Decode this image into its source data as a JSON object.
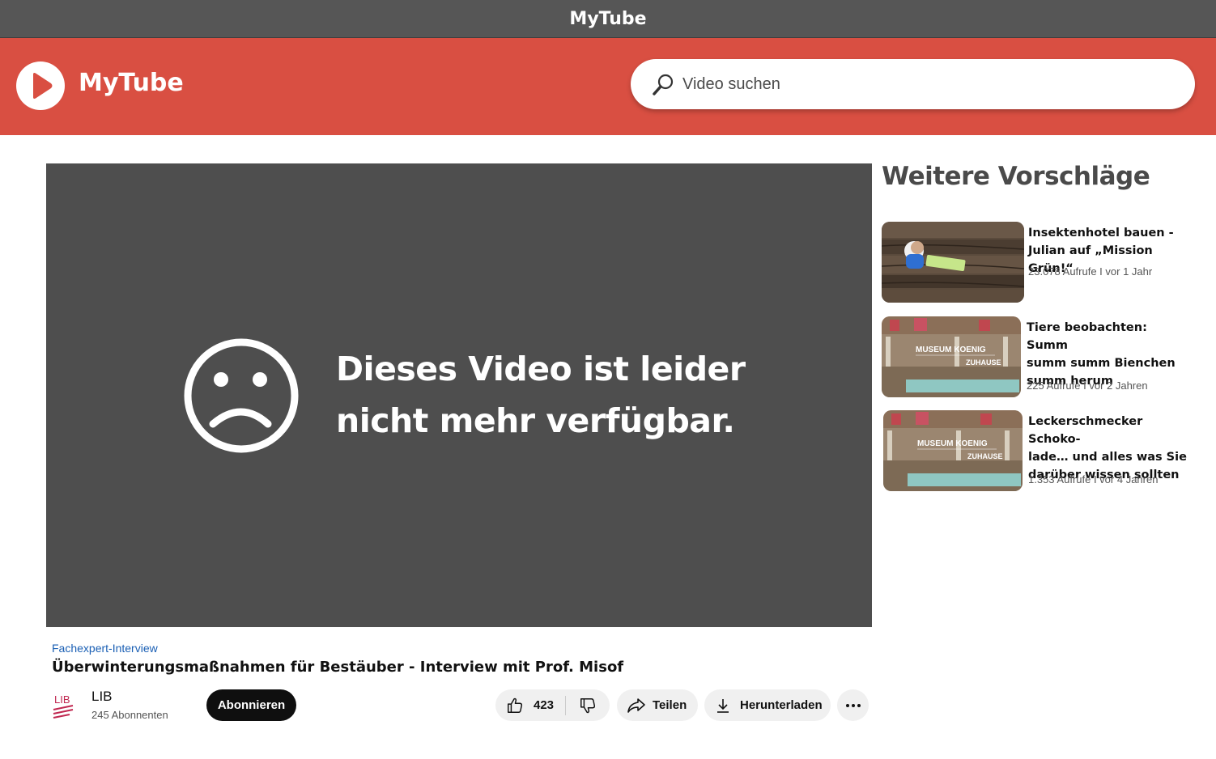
{
  "window": {
    "title": "MyTube"
  },
  "header": {
    "logo_text": "MyTube",
    "search_placeholder": "Video suchen"
  },
  "player": {
    "message_line1": "Dieses Video ist leider",
    "message_line2": "nicht mehr verfügbar."
  },
  "video": {
    "category": "Fachexpert-Interview",
    "title": "Überwinterungsmaßnahmen für Bestäuber - Interview mit Prof. Misof",
    "channel": {
      "logo_text": "LIB",
      "name": "LIB",
      "subscribers": "245 Abonnenten"
    },
    "subscribe_label": "Abonnieren",
    "likes": "423",
    "share_label": "Teilen",
    "download_label": "Herunterladen"
  },
  "sidebar": {
    "title": "Weitere Vorschläge",
    "items": [
      {
        "title_line1": "Insektenhotel bauen -",
        "title_line2": "Julian auf „Mission Grün!“",
        "title_line3": "",
        "meta": "23.078 Aufrufe I vor 1 Jahr",
        "thumb": "wooden-insect-hotel"
      },
      {
        "title_line1": "Tiere beobachten: Summ",
        "title_line2": "summ summ Bienchen",
        "title_line3": "summ herum",
        "meta": "225 Aufrufe I vor 2 Jahren",
        "thumb": "museum-hall",
        "thumb_line1": "MUSEUM KOENIG",
        "thumb_line2": "ZUHAUSE"
      },
      {
        "title_line1": "Leckerschmecker Schoko-",
        "title_line2": "lade… und alles was Sie",
        "title_line3": "darüber wissen sollten",
        "meta": "1.353  Aufrufe I vor 4 Jahren",
        "thumb": "museum-hall",
        "thumb_line1": "MUSEUM KOENIG",
        "thumb_line2": "ZUHAUSE"
      }
    ]
  },
  "colors": {
    "brand_red": "#d94f42",
    "titlebar": "#565656",
    "player_bg": "#4e4e4e",
    "link_blue": "#1a5fb4"
  }
}
